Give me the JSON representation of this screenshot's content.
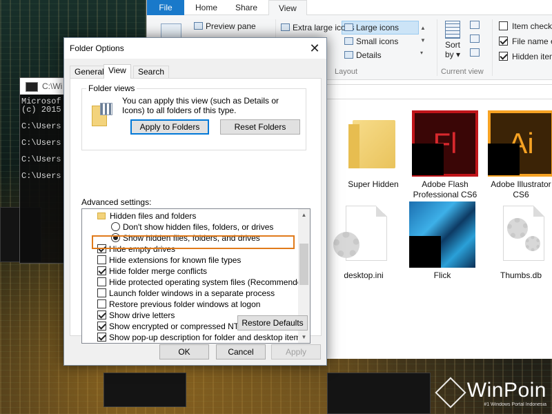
{
  "explorer": {
    "tabs": {
      "file": "File",
      "home": "Home",
      "share": "Share",
      "view": "View"
    },
    "ribbon": {
      "preview_pane": "Preview pane",
      "extra_large_icons": "Extra large icons",
      "large_icons": "Large icons",
      "small_icons": "Small icons",
      "details": "Details",
      "layout_group": "Layout",
      "sort_by": "Sort",
      "sort_by_line2": "by",
      "current_view_group": "Current view",
      "item_check_boxes": "Item check",
      "item_check_boxes_checked": false,
      "file_name_extensions": "File name e",
      "file_name_extensions_checked": true,
      "hidden_items": "Hidden item",
      "hidden_items_checked": true
    },
    "files": [
      {
        "name": "Super Hidden",
        "type": "folder"
      },
      {
        "name": "Adobe Flash Professional CS6",
        "type": "app",
        "glyph": "Fl",
        "color": "#c0151a"
      },
      {
        "name": "Adobe Illustrator CS6",
        "type": "app",
        "glyph": "Ai",
        "color": "#f6a223"
      },
      {
        "name": "desktop.ini",
        "type": "settings"
      },
      {
        "name": "Flick",
        "type": "app"
      },
      {
        "name": "Thumbs.db",
        "type": "settings"
      }
    ]
  },
  "console": {
    "title": "C:\\Wi",
    "lines": [
      "Microsof",
      "(c) 2015",
      "",
      "C:\\Users",
      "",
      "C:\\Users",
      "",
      "C:\\Users",
      "",
      "C:\\Users"
    ]
  },
  "dialog": {
    "title": "Folder Options",
    "close_glyph": "✕",
    "tabs": [
      "General",
      "View",
      "Search"
    ],
    "active_tab": "View",
    "folder_views": {
      "legend": "Folder views",
      "text": "You can apply this view (such as Details or Icons) to all folders of this type.",
      "apply_button": "Apply to Folders",
      "reset_button": "Reset Folders"
    },
    "advanced_label": "Advanced settings:",
    "advanced_items": [
      {
        "label": "Hidden files and folders",
        "kind": "folder"
      },
      {
        "label": "Don't show hidden files, folders, or drives",
        "kind": "radio",
        "checked": false
      },
      {
        "label": "Show hidden files, folders, and drives",
        "kind": "radio",
        "checked": true
      },
      {
        "label": "Hide empty drives",
        "kind": "checkbox",
        "checked": true
      },
      {
        "label": "Hide extensions for known file types",
        "kind": "checkbox",
        "checked": false
      },
      {
        "label": "Hide folder merge conflicts",
        "kind": "checkbox",
        "checked": true
      },
      {
        "label": "Hide protected operating system files (Recommended)",
        "kind": "checkbox",
        "checked": false
      },
      {
        "label": "Launch folder windows in a separate process",
        "kind": "checkbox",
        "checked": false
      },
      {
        "label": "Restore previous folder windows at logon",
        "kind": "checkbox",
        "checked": false
      },
      {
        "label": "Show drive letters",
        "kind": "checkbox",
        "checked": true
      },
      {
        "label": "Show encrypted or compressed NTFS files in color",
        "kind": "checkbox",
        "checked": true
      },
      {
        "label": "Show pop-up description for folder and desktop items",
        "kind": "checkbox",
        "checked": true
      }
    ],
    "restore_defaults": "Restore Defaults",
    "ok": "OK",
    "cancel": "Cancel",
    "apply": "Apply"
  },
  "watermark": {
    "name": "WinPoin",
    "tagline": "#1 Windows Portal Indonesia"
  },
  "colors": {
    "accent": "#1979ca",
    "highlight": "#e07a1a",
    "selection": "#cce4f7"
  }
}
